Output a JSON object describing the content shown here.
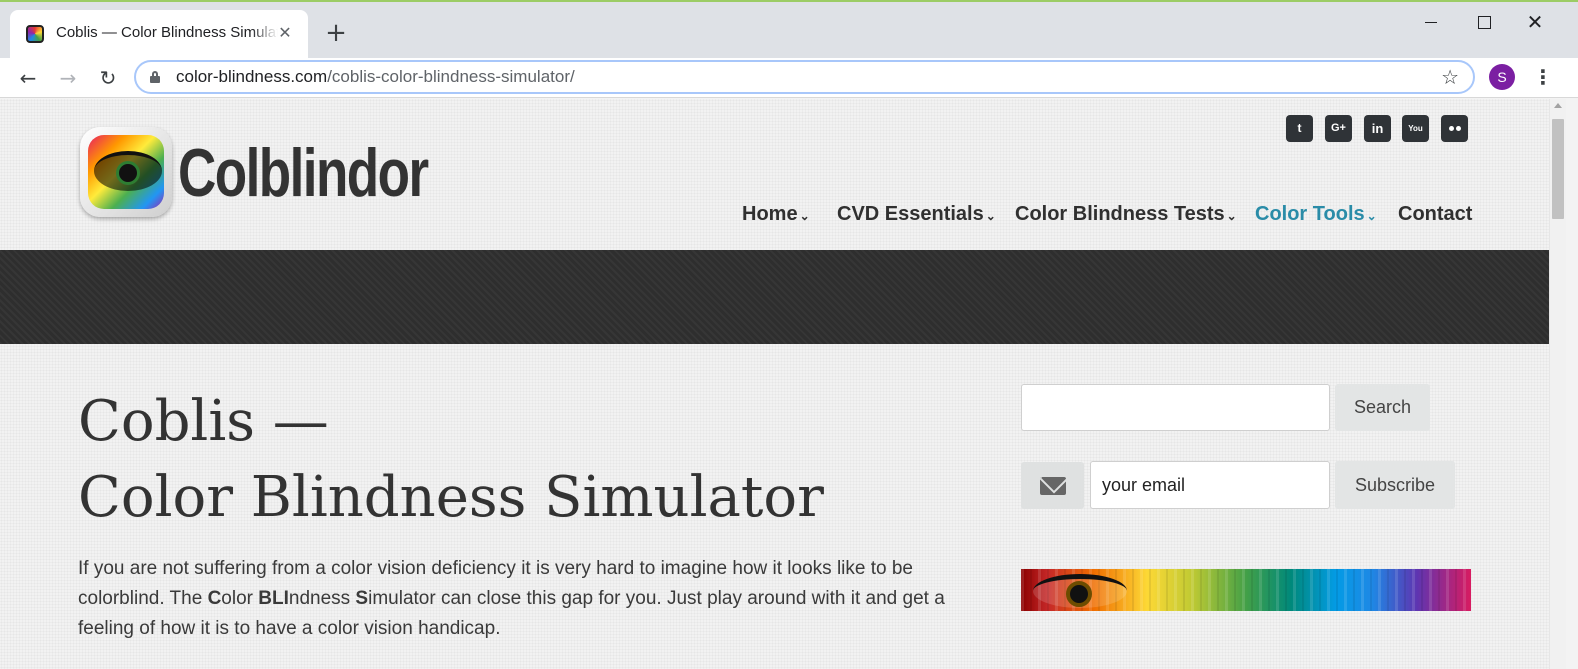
{
  "browser": {
    "tab_title": "Coblis — Color Blindness Simulator",
    "tab_close": "✕",
    "new_tab": "+",
    "url_host": "color-blindness.com",
    "url_path": "/coblis-color-blindness-simulator/",
    "profile_initial": "S",
    "icons": [
      "back-arrow-icon",
      "forward-arrow-icon",
      "reload-icon",
      "lock-icon",
      "star-icon",
      "menu-dots-icon"
    ]
  },
  "site": {
    "logo_text": "Colblindor",
    "social": [
      {
        "name": "twitter",
        "glyph": "t"
      },
      {
        "name": "google-plus",
        "glyph": "G+"
      },
      {
        "name": "linkedin",
        "glyph": "in"
      },
      {
        "name": "youtube",
        "glyph": "You"
      },
      {
        "name": "flickr",
        "glyph": ""
      }
    ],
    "nav": {
      "home": "Home",
      "cvd": "CVD Essentials",
      "tests": "Color Blindness Tests",
      "tools": "Color Tools",
      "contact": "Contact"
    },
    "accent_color": "#2a8ca8"
  },
  "main": {
    "title_line1": "Coblis —",
    "title_line2": "Color Blindness Simulator",
    "intro_part1": "If you are not suffering from a color vision deficiency it is very hard to imagine how it looks like to be colorblind. The ",
    "intro_c": "C",
    "intro_olor": "olor ",
    "intro_bli": "BLI",
    "intro_ndness": "ndness ",
    "intro_s": "S",
    "intro_rest": "imulator can close this gap for you. Just play around with it and get a feeling of how it is to have a color vision handicap."
  },
  "sidebar": {
    "search_value": "",
    "search_button": "Search",
    "email_placeholder": "your email",
    "subscribe_button": "Subscribe"
  }
}
